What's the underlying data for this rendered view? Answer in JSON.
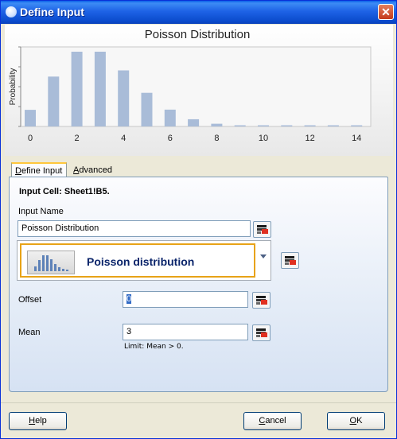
{
  "window": {
    "title": "Define Input",
    "close_label": "✕"
  },
  "chart_data": {
    "type": "bar",
    "title": "Poisson Distribution",
    "ylabel": "Probability",
    "xlabel": "",
    "x": [
      0,
      1,
      2,
      3,
      4,
      5,
      6,
      7,
      8,
      9,
      10,
      11,
      12,
      13,
      14
    ],
    "values": [
      0.0498,
      0.1494,
      0.224,
      0.224,
      0.168,
      0.1008,
      0.0504,
      0.0216,
      0.0081,
      0.0027,
      0.0008,
      0.0002,
      0.0001,
      0.0,
      0.0
    ],
    "x_ticks": [
      "0",
      "2",
      "4",
      "6",
      "8",
      "10",
      "12",
      "14"
    ],
    "xlim": [
      0,
      14
    ],
    "ylim": [
      0,
      0.224
    ],
    "bar_color": "#A9BCD8",
    "grid": false
  },
  "tabs": [
    {
      "label_pre": "",
      "label_u": "D",
      "label_post": "efine Input",
      "active": true
    },
    {
      "label_pre": "",
      "label_u": "A",
      "label_post": "dvanced",
      "active": false
    }
  ],
  "form": {
    "input_cell": "Input Cell: Sheet1!B5.",
    "input_name_label": "Input Name",
    "input_name_value": "Poisson Distribution",
    "distribution_label": "Poisson distribution",
    "offset_label": "Offset",
    "offset_value": "0",
    "mean_label": "Mean",
    "mean_value": "3",
    "limit_text": "Limit: Mean > 0."
  },
  "buttons": {
    "help_u": "H",
    "help_rest": "elp",
    "cancel_u": "C",
    "cancel_rest": "ancel",
    "ok_u": "O",
    "ok_rest": "K"
  },
  "colors": {
    "titlebar": "#0A5FE8",
    "accent_border": "#E8A317",
    "bar": "#A9BCD8"
  }
}
